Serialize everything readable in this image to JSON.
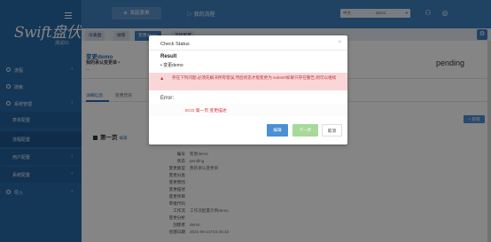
{
  "sidebar": {
    "logo_text": "Swift盘伏",
    "logo_sub": "测试01",
    "items": [
      {
        "label": "流程",
        "chevron": "‹"
      },
      {
        "label": "搜索",
        "chevron": ""
      },
      {
        "label": "系统管理",
        "chevron": "‹"
      }
    ],
    "sub_items": [
      {
        "label": "表单配置",
        "chevron": ""
      },
      {
        "label": "流程配置",
        "chevron": ""
      },
      {
        "label": "用户配置",
        "chevron": "‹"
      },
      {
        "label": "系统配置",
        "chevron": "‹"
      },
      {
        "label": "导入",
        "chevron": "‹"
      }
    ]
  },
  "topbar": {
    "start_button": "发起表单",
    "my_flow": "我的流程",
    "lang_select": "中文",
    "user_select": "demo"
  },
  "tabs": [
    {
      "label": "仪表盘"
    },
    {
      "label": "搜索"
    },
    {
      "label": "变更demo"
    },
    {
      "label": "流程配置"
    }
  ],
  "document": {
    "title": "变更demo",
    "subtitle": "我的承认变更单 •",
    "subtitle2": "...",
    "status": "pending",
    "subtabs": [
      "详细信息",
      "变更历史"
    ],
    "add_button": "+ 新增",
    "page_head": "第一页",
    "page_edit": "编辑",
    "fields": [
      {
        "k": "编号",
        "v": "变更demo"
      },
      {
        "k": "状态",
        "v": "pending"
      },
      {
        "k": "变更类型",
        "v": "我的承认变更单"
      },
      {
        "k": "变更分类",
        "v": ""
      },
      {
        "k": "变更原因",
        "v": ""
      },
      {
        "k": "变更描述",
        "v": ""
      },
      {
        "k": "变更项目",
        "v": ""
      },
      {
        "k": "审批代码",
        "v": ""
      },
      {
        "k": "工作流",
        "v": "工作流配置示例demo"
      },
      {
        "k": "变更分析",
        "v": ""
      },
      {
        "k": "创建者",
        "v": "demo"
      },
      {
        "k": "创建日期",
        "v": "2021-09-21T10:45:42"
      }
    ]
  },
  "modal": {
    "title": "Check Status",
    "close": "×",
    "result_heading": "Result",
    "result_item": "• 变更demo",
    "warning_icon": "warning-triangle-icon",
    "warning_text": "存在下列问题,必须先解决所有错误,然后状态才能变更为 submit!如果只存在警告,则可以继续",
    "error_heading": "Error:",
    "error_item": "ECO 第一页 变更描述",
    "buttons": {
      "primary": "编辑",
      "next": "下一步",
      "cancel": "取消"
    }
  },
  "colors": {
    "sidebar": "#2a6aa8",
    "topbar": "#3f7fbf",
    "warning_bg": "#f9d7d9",
    "error_text": "#e0303a",
    "next_disabled": "#a6d99a"
  }
}
